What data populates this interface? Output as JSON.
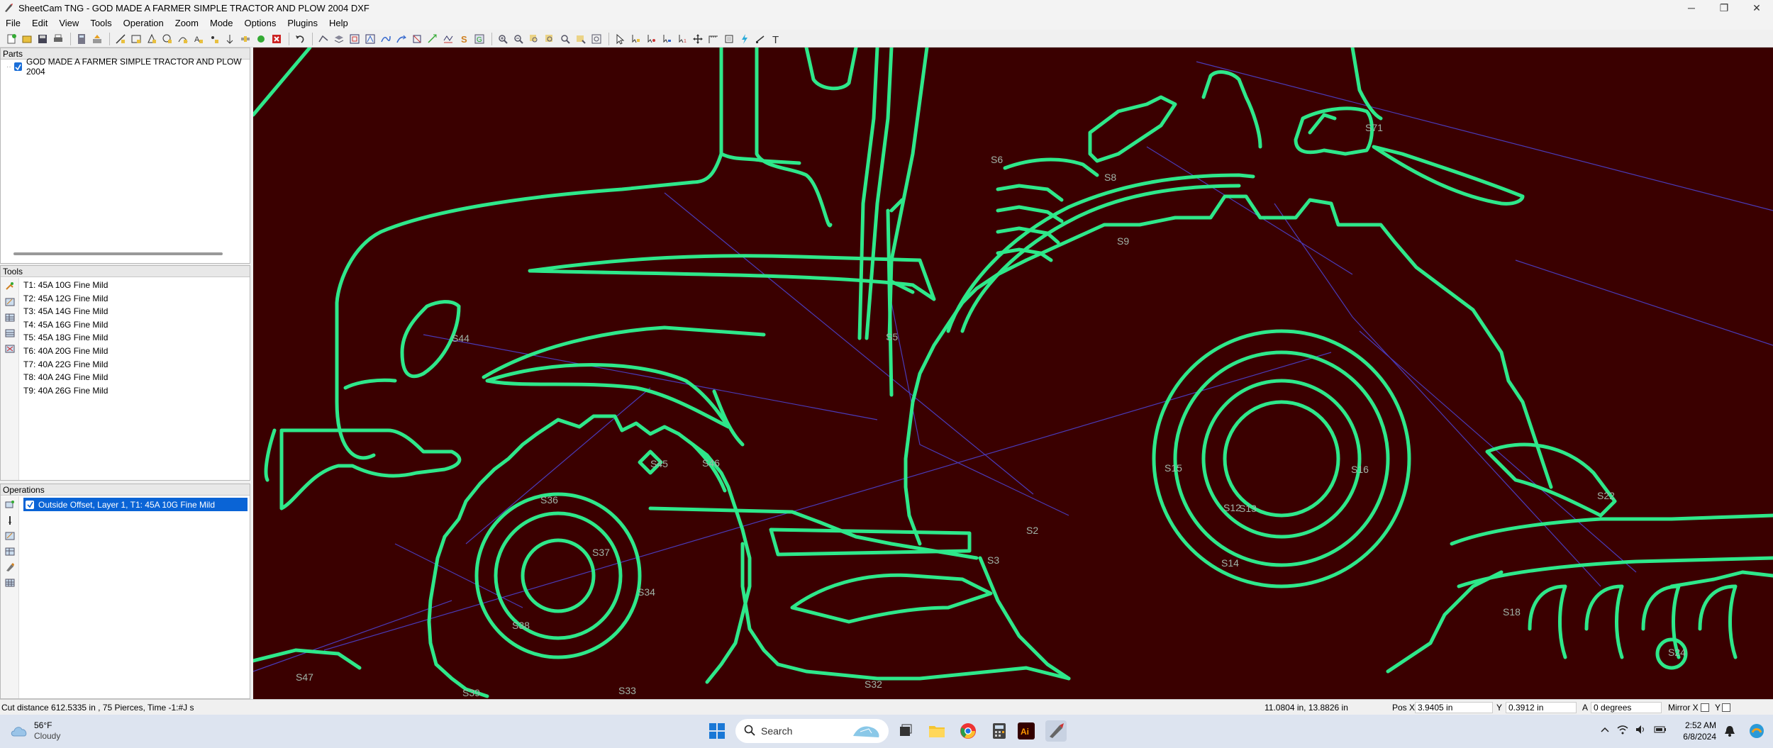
{
  "window": {
    "title": "SheetCam TNG - GOD MADE A FARMER SIMPLE TRACTOR AND PLOW 2004 DXF",
    "controls": {
      "minimize": "─",
      "maximize": "❐",
      "close": "✕"
    }
  },
  "menu": [
    "File",
    "Edit",
    "View",
    "Tools",
    "Operation",
    "Zoom",
    "Mode",
    "Options",
    "Plugins",
    "Help"
  ],
  "parts": {
    "header": "Parts",
    "items": [
      {
        "label": "GOD MADE A FARMER SIMPLE TRACTOR AND PLOW 2004",
        "checked": true
      }
    ]
  },
  "tools": {
    "header": "Tools",
    "items": [
      "T1: 45A 10G Fine Mild",
      "T2: 45A 12G Fine Mild",
      "T3: 45A 14G Fine Mild",
      "T4: 45A 16G Fine Mild",
      "T5: 45A 18G Fine Mild",
      "T6: 40A 20G Fine Mild",
      "T7: 40A 22G Fine Mild",
      "T8: 40A 24G Fine Mild",
      "T9: 40A 26G Fine Mild"
    ]
  },
  "operations": {
    "header": "Operations",
    "items": [
      {
        "label": "Outside Offset, Layer 1, T1: 45A 10G Fine Mild",
        "checked": true,
        "selected": true
      }
    ]
  },
  "canvas": {
    "background": "#3a0000",
    "path_color": "#2ee88a",
    "rapid_color": "#4a3ab8",
    "shape_labels": [
      "S6",
      "S8",
      "S9",
      "S71",
      "S44",
      "S45",
      "S46",
      "S36",
      "S37",
      "S34",
      "S38",
      "S47",
      "S33",
      "S32",
      "S2",
      "S3",
      "S12",
      "S13",
      "S14",
      "S15",
      "S16",
      "S18",
      "S22",
      "S24",
      "S5",
      "S39"
    ]
  },
  "status": {
    "cut_info": "Cut distance 612.5335 in , 75 Pierces, Time -1:#J s",
    "cursor_pos": "11.0804 in, 13.8826 in",
    "pos_x_label": "Pos X",
    "pos_x": "3.9405 in",
    "y_label": "Y",
    "y": "0.3912 in",
    "a_label": "A",
    "a": "0 degrees",
    "mirror_x": "Mirror X",
    "mirror_y": "Y"
  },
  "taskbar": {
    "weather_temp": "56°F",
    "weather_desc": "Cloudy",
    "search_placeholder": "Search",
    "time": "2:52 AM",
    "date": "6/8/2024"
  }
}
